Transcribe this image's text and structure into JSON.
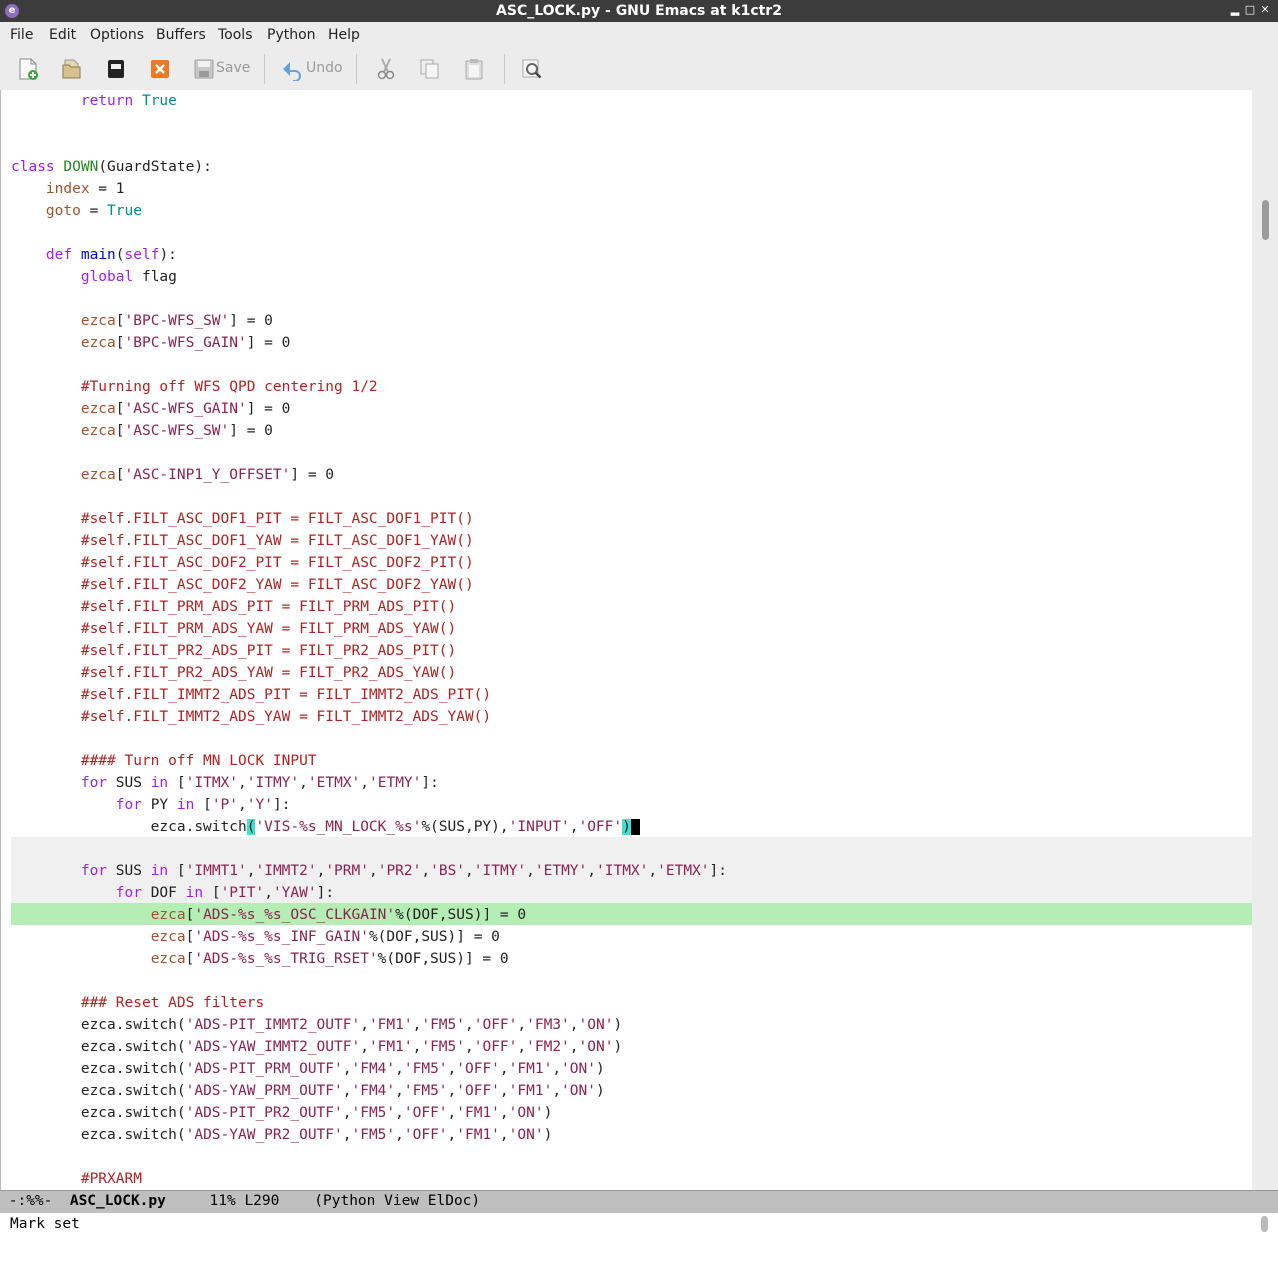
{
  "window": {
    "title": "ASC_LOCK.py - GNU Emacs at k1ctr2",
    "app_icon": "emacs-icon",
    "buttons": [
      "minimize",
      "maximize",
      "close"
    ]
  },
  "menu": {
    "items": [
      "File",
      "Edit",
      "Options",
      "Buffers",
      "Tools",
      "Python",
      "Help"
    ]
  },
  "toolbar": {
    "save_label": "Save",
    "undo_label": "Undo",
    "icons": [
      "new-file-icon",
      "open-file-icon",
      "open-directory-icon",
      "close-buffer-icon",
      "save-icon",
      "undo-icon",
      "cut-icon",
      "copy-icon",
      "paste-icon",
      "search-icon"
    ]
  },
  "editor": {
    "lines": [
      [
        [
          null,
          "        "
        ],
        [
          "kw",
          "return"
        ],
        [
          null,
          " "
        ],
        [
          "cs",
          "True"
        ]
      ],
      [],
      [],
      [
        [
          "kw",
          "class"
        ],
        [
          null,
          " "
        ],
        [
          "ty",
          "DOWN"
        ],
        [
          null,
          "(GuardState):"
        ]
      ],
      [
        [
          null,
          "    "
        ],
        [
          "vr",
          "index"
        ],
        [
          null,
          " = 1"
        ]
      ],
      [
        [
          null,
          "    "
        ],
        [
          "vr",
          "goto"
        ],
        [
          null,
          " = "
        ],
        [
          "cs",
          "True"
        ]
      ],
      [],
      [
        [
          null,
          "    "
        ],
        [
          "kw",
          "def"
        ],
        [
          null,
          " "
        ],
        [
          "fn",
          "main"
        ],
        [
          null,
          "("
        ],
        [
          "kw",
          "self"
        ],
        [
          null,
          "):"
        ]
      ],
      [
        [
          null,
          "        "
        ],
        [
          "kw",
          "global"
        ],
        [
          null,
          " flag"
        ]
      ],
      [],
      [
        [
          null,
          "        "
        ],
        [
          "vr",
          "ezca"
        ],
        [
          null,
          "["
        ],
        [
          "st",
          "'BPC-WFS_SW'"
        ],
        [
          null,
          "] = 0"
        ]
      ],
      [
        [
          null,
          "        "
        ],
        [
          "vr",
          "ezca"
        ],
        [
          null,
          "["
        ],
        [
          "st",
          "'BPC-WFS_GAIN'"
        ],
        [
          null,
          "] = 0"
        ]
      ],
      [],
      [
        [
          null,
          "        "
        ],
        [
          "cm",
          "#Turning off WFS QPD centering 1/2"
        ]
      ],
      [
        [
          null,
          "        "
        ],
        [
          "vr",
          "ezca"
        ],
        [
          null,
          "["
        ],
        [
          "st",
          "'ASC-WFS_GAIN'"
        ],
        [
          null,
          "] = 0"
        ]
      ],
      [
        [
          null,
          "        "
        ],
        [
          "vr",
          "ezca"
        ],
        [
          null,
          "["
        ],
        [
          "st",
          "'ASC-WFS_SW'"
        ],
        [
          null,
          "] = 0"
        ]
      ],
      [],
      [
        [
          null,
          "        "
        ],
        [
          "vr",
          "ezca"
        ],
        [
          null,
          "["
        ],
        [
          "st",
          "'ASC-INP1_Y_OFFSET'"
        ],
        [
          null,
          "] = 0"
        ]
      ],
      [],
      [
        [
          null,
          "        "
        ],
        [
          "cm",
          "#self.FILT_ASC_DOF1_PIT = FILT_ASC_DOF1_PIT()"
        ]
      ],
      [
        [
          null,
          "        "
        ],
        [
          "cm",
          "#self.FILT_ASC_DOF1_YAW = FILT_ASC_DOF1_YAW()"
        ]
      ],
      [
        [
          null,
          "        "
        ],
        [
          "cm",
          "#self.FILT_ASC_DOF2_PIT = FILT_ASC_DOF2_PIT()"
        ]
      ],
      [
        [
          null,
          "        "
        ],
        [
          "cm",
          "#self.FILT_ASC_DOF2_YAW = FILT_ASC_DOF2_YAW()"
        ]
      ],
      [
        [
          null,
          "        "
        ],
        [
          "cm",
          "#self.FILT_PRM_ADS_PIT = FILT_PRM_ADS_PIT()"
        ]
      ],
      [
        [
          null,
          "        "
        ],
        [
          "cm",
          "#self.FILT_PRM_ADS_YAW = FILT_PRM_ADS_YAW()"
        ]
      ],
      [
        [
          null,
          "        "
        ],
        [
          "cm",
          "#self.FILT_PR2_ADS_PIT = FILT_PR2_ADS_PIT()"
        ]
      ],
      [
        [
          null,
          "        "
        ],
        [
          "cm",
          "#self.FILT_PR2_ADS_YAW = FILT_PR2_ADS_YAW()"
        ]
      ],
      [
        [
          null,
          "        "
        ],
        [
          "cm",
          "#self.FILT_IMMT2_ADS_PIT = FILT_IMMT2_ADS_PIT()"
        ]
      ],
      [
        [
          null,
          "        "
        ],
        [
          "cm",
          "#self.FILT_IMMT2_ADS_YAW = FILT_IMMT2_ADS_YAW()"
        ]
      ],
      [],
      [
        [
          null,
          "        "
        ],
        [
          "cm",
          "#### Turn off MN LOCK INPUT"
        ]
      ],
      [
        [
          null,
          "        "
        ],
        [
          "kw",
          "for"
        ],
        [
          null,
          " SUS "
        ],
        [
          "kw",
          "in"
        ],
        [
          null,
          " ["
        ],
        [
          "st",
          "'ITMX'"
        ],
        [
          null,
          ","
        ],
        [
          "st",
          "'ITMY'"
        ],
        [
          null,
          ","
        ],
        [
          "st",
          "'ETMX'"
        ],
        [
          null,
          ","
        ],
        [
          "st",
          "'ETMY'"
        ],
        [
          null,
          "]:"
        ]
      ],
      [
        [
          null,
          "            "
        ],
        [
          "kw",
          "for"
        ],
        [
          null,
          " PY "
        ],
        [
          "kw",
          "in"
        ],
        [
          null,
          " ["
        ],
        [
          "st",
          "'P'"
        ],
        [
          null,
          ","
        ],
        [
          "st",
          "'Y'"
        ],
        [
          null,
          "]:"
        ]
      ],
      [
        [
          null,
          "                ezca.switch"
        ],
        [
          "pm",
          "("
        ],
        [
          "st",
          "'VIS-%s_MN_LOCK_%s'"
        ],
        [
          null,
          "%(SUS,PY),"
        ],
        [
          "st",
          "'INPUT'"
        ],
        [
          null,
          ","
        ],
        [
          "st",
          "'OFF'"
        ],
        [
          "pm",
          ")"
        ],
        [
          "cursor",
          " "
        ]
      ],
      [],
      [
        [
          null,
          "        "
        ],
        [
          "kw",
          "for"
        ],
        [
          null,
          " SUS "
        ],
        [
          "kw",
          "in"
        ],
        [
          null,
          " ["
        ],
        [
          "st",
          "'IMMT1'"
        ],
        [
          null,
          ","
        ],
        [
          "st",
          "'IMMT2'"
        ],
        [
          null,
          ","
        ],
        [
          "st",
          "'PRM'"
        ],
        [
          null,
          ","
        ],
        [
          "st",
          "'PR2'"
        ],
        [
          null,
          ","
        ],
        [
          "st",
          "'BS'"
        ],
        [
          null,
          ","
        ],
        [
          "st",
          "'ITMY'"
        ],
        [
          null,
          ","
        ],
        [
          "st",
          "'ETMY'"
        ],
        [
          null,
          ","
        ],
        [
          "st",
          "'ITMX'"
        ],
        [
          null,
          ","
        ],
        [
          "st",
          "'ETMX'"
        ],
        [
          null,
          "]:"
        ]
      ],
      [
        [
          null,
          "            "
        ],
        [
          "kw",
          "for"
        ],
        [
          null,
          " DOF "
        ],
        [
          "kw",
          "in"
        ],
        [
          null,
          " ["
        ],
        [
          "st",
          "'PIT'"
        ],
        [
          null,
          ","
        ],
        [
          "st",
          "'YAW'"
        ],
        [
          null,
          "]:"
        ]
      ],
      [
        [
          null,
          "                "
        ],
        [
          "vr",
          "ezca"
        ],
        [
          null,
          "["
        ],
        [
          "st",
          "'ADS-%s_%s_OSC_CLKGAIN'"
        ],
        [
          null,
          "%(DOF,SUS)] = 0"
        ]
      ],
      [
        [
          null,
          "                "
        ],
        [
          "vr",
          "ezca"
        ],
        [
          null,
          "["
        ],
        [
          "st",
          "'ADS-%s_%s_INF_GAIN'"
        ],
        [
          null,
          "%(DOF,SUS)] = 0"
        ]
      ],
      [
        [
          null,
          "                "
        ],
        [
          "vr",
          "ezca"
        ],
        [
          null,
          "["
        ],
        [
          "st",
          "'ADS-%s_%s_TRIG_RSET'"
        ],
        [
          null,
          "%(DOF,SUS)] = 0"
        ]
      ],
      [],
      [
        [
          null,
          "        "
        ],
        [
          "cm",
          "### Reset ADS filters"
        ]
      ],
      [
        [
          null,
          "        ezca.switch("
        ],
        [
          "st",
          "'ADS-PIT_IMMT2_OUTF'"
        ],
        [
          null,
          ","
        ],
        [
          "st",
          "'FM1'"
        ],
        [
          null,
          ","
        ],
        [
          "st",
          "'FM5'"
        ],
        [
          null,
          ","
        ],
        [
          "st",
          "'OFF'"
        ],
        [
          null,
          ","
        ],
        [
          "st",
          "'FM3'"
        ],
        [
          null,
          ","
        ],
        [
          "st",
          "'ON'"
        ],
        [
          null,
          ")"
        ]
      ],
      [
        [
          null,
          "        ezca.switch("
        ],
        [
          "st",
          "'ADS-YAW_IMMT2_OUTF'"
        ],
        [
          null,
          ","
        ],
        [
          "st",
          "'FM1'"
        ],
        [
          null,
          ","
        ],
        [
          "st",
          "'FM5'"
        ],
        [
          null,
          ","
        ],
        [
          "st",
          "'OFF'"
        ],
        [
          null,
          ","
        ],
        [
          "st",
          "'FM2'"
        ],
        [
          null,
          ","
        ],
        [
          "st",
          "'ON'"
        ],
        [
          null,
          ")"
        ]
      ],
      [
        [
          null,
          "        ezca.switch("
        ],
        [
          "st",
          "'ADS-PIT_PRM_OUTF'"
        ],
        [
          null,
          ","
        ],
        [
          "st",
          "'FM4'"
        ],
        [
          null,
          ","
        ],
        [
          "st",
          "'FM5'"
        ],
        [
          null,
          ","
        ],
        [
          "st",
          "'OFF'"
        ],
        [
          null,
          ","
        ],
        [
          "st",
          "'FM1'"
        ],
        [
          null,
          ","
        ],
        [
          "st",
          "'ON'"
        ],
        [
          null,
          ")"
        ]
      ],
      [
        [
          null,
          "        ezca.switch("
        ],
        [
          "st",
          "'ADS-YAW_PRM_OUTF'"
        ],
        [
          null,
          ","
        ],
        [
          "st",
          "'FM4'"
        ],
        [
          null,
          ","
        ],
        [
          "st",
          "'FM5'"
        ],
        [
          null,
          ","
        ],
        [
          "st",
          "'OFF'"
        ],
        [
          null,
          ","
        ],
        [
          "st",
          "'FM1'"
        ],
        [
          null,
          ","
        ],
        [
          "st",
          "'ON'"
        ],
        [
          null,
          ")"
        ]
      ],
      [
        [
          null,
          "        ezca.switch("
        ],
        [
          "st",
          "'ADS-PIT_PR2_OUTF'"
        ],
        [
          null,
          ","
        ],
        [
          "st",
          "'FM5'"
        ],
        [
          null,
          ","
        ],
        [
          "st",
          "'OFF'"
        ],
        [
          null,
          ","
        ],
        [
          "st",
          "'FM1'"
        ],
        [
          null,
          ","
        ],
        [
          "st",
          "'ON'"
        ],
        [
          null,
          ")"
        ]
      ],
      [
        [
          null,
          "        ezca.switch("
        ],
        [
          "st",
          "'ADS-YAW_PR2_OUTF'"
        ],
        [
          null,
          ","
        ],
        [
          "st",
          "'FM5'"
        ],
        [
          null,
          ","
        ],
        [
          "st",
          "'OFF'"
        ],
        [
          null,
          ","
        ],
        [
          "st",
          "'FM1'"
        ],
        [
          null,
          ","
        ],
        [
          "st",
          "'ON'"
        ],
        [
          null,
          ")"
        ]
      ],
      [],
      [
        [
          null,
          "        "
        ],
        [
          "cm",
          "#PRXARM"
        ]
      ]
    ]
  },
  "modeline": {
    "status": " -:%%-  ",
    "buffer": "ASC_LOCK.py",
    "position": "     11% L290    ",
    "modes": "(Python View ElDoc)"
  },
  "minibuffer": {
    "message": "Mark set"
  },
  "colors": {
    "keyword": "#a020f0",
    "function": "#0000ff",
    "type": "#228b22",
    "constant": "#008b8b",
    "variable": "#a0522d",
    "string": "#8b2252",
    "comment": "#b22222",
    "current_line": "#b4eeb4",
    "paren_match": "#40e0d0"
  }
}
